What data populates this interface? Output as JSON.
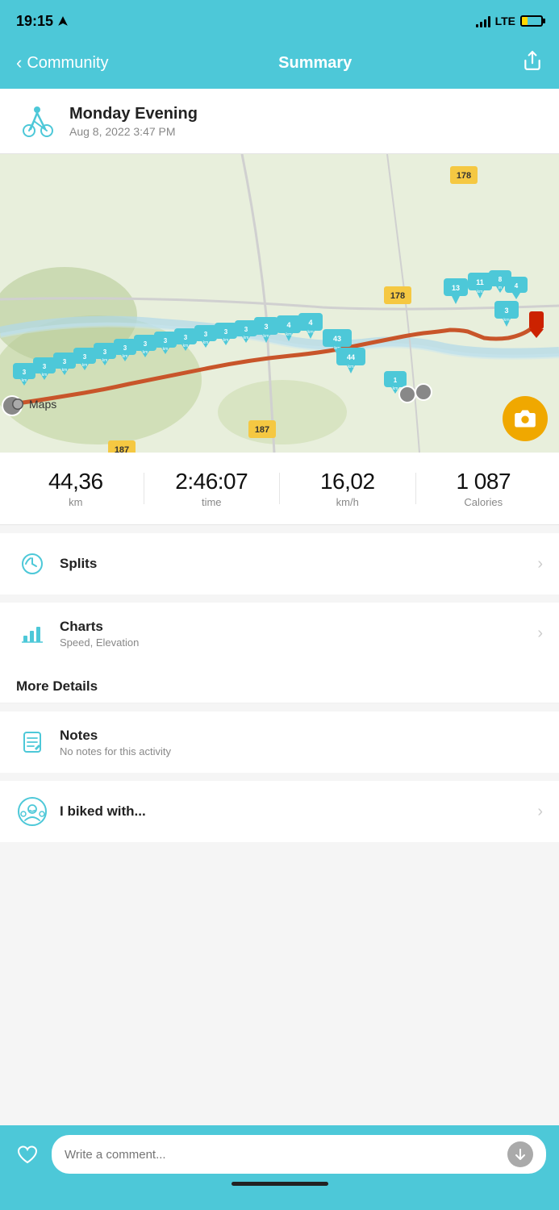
{
  "status_bar": {
    "time": "19:15",
    "lte": "LTE"
  },
  "nav": {
    "back_label": "Community",
    "title": "Summary"
  },
  "activity": {
    "title": "Monday Evening",
    "date": "Aug 8, 2022 3:47 PM"
  },
  "stats": {
    "distance_value": "44,36",
    "distance_unit": "km",
    "time_value": "2:46:07",
    "time_unit": "time",
    "speed_value": "16,02",
    "speed_unit": "km/h",
    "calories_value": "1 087",
    "calories_unit": "Calories"
  },
  "menu": {
    "splits_label": "Splits",
    "charts_label": "Charts",
    "charts_sub": "Speed, Elevation",
    "more_details": "More Details",
    "notes_label": "Notes",
    "notes_sub": "No notes for this activity",
    "biked_label": "I biked with..."
  },
  "bottom": {
    "comment_placeholder": "Write a comment..."
  },
  "map": {
    "badge": "Maps"
  }
}
